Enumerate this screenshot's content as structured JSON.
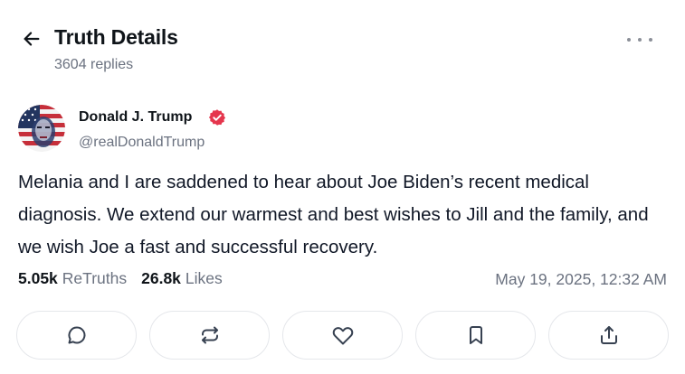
{
  "header": {
    "title": "Truth Details",
    "replies": "3604 replies",
    "back_icon": "arrow-left-icon",
    "more_icon": "more-horizontal-icon"
  },
  "post": {
    "author": {
      "name": "Donald J. Trump",
      "handle": "@realDonaldTrump",
      "verified": true,
      "verified_color": "#e5364d"
    },
    "text": "Melania and I are saddened to hear about Joe Biden’s recent medical diagnosis. We extend our warmest and best wishes to Jill and the family, and we wish Joe a fast and successful recovery.",
    "stats": {
      "retruths_count": "5.05k",
      "retruths_label": "ReTruths",
      "likes_count": "26.8k",
      "likes_label": "Likes"
    },
    "timestamp": "May 19, 2025, 12:32 AM"
  },
  "actions": [
    {
      "name": "reply",
      "icon": "comment-icon"
    },
    {
      "name": "retruth",
      "icon": "repost-icon"
    },
    {
      "name": "like",
      "icon": "heart-icon"
    },
    {
      "name": "bookmark",
      "icon": "bookmark-icon"
    },
    {
      "name": "share",
      "icon": "share-icon"
    }
  ],
  "colors": {
    "text": "#0f1419",
    "muted": "#6b7280",
    "border": "#e5e7eb",
    "icon": "#374151"
  }
}
